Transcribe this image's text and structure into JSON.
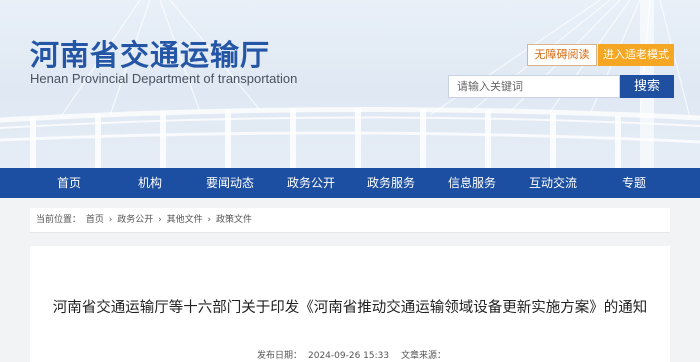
{
  "header": {
    "title_cn": "河南省交通运输厅",
    "title_en": "Henan Provincial Department of transportation",
    "accessibility_label": "无障碍阅读",
    "elder_mode_label": "进入适老模式",
    "search": {
      "placeholder": "请输入关键词",
      "button_label": "搜索"
    }
  },
  "nav": {
    "items": [
      "首页",
      "机构",
      "要闻动态",
      "政务公开",
      "政务服务",
      "信息服务",
      "互动交流",
      "专题"
    ]
  },
  "breadcrumb": {
    "prefix": "当前位置：",
    "items": [
      "首页",
      "政务公开",
      "其他文件",
      "政策文件"
    ],
    "separator": "›"
  },
  "article": {
    "title": "河南省交通运输厅等十六部门关于印发《河南省推动交通运输领域设备更新实施方案》的通知",
    "published_label": "发布日期：",
    "published_value": "2024-09-26 15:33",
    "source_label": "文章来源："
  },
  "colors": {
    "brand_blue": "#1c4ea1",
    "logo_blue": "#2556a6",
    "accent_orange": "#f5a623"
  }
}
